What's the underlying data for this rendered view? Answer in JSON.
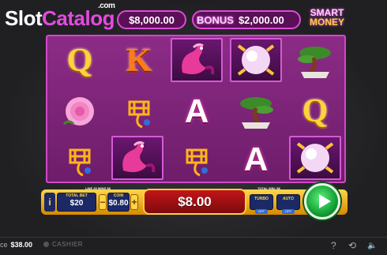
{
  "header": {
    "logo_slot": "Slot",
    "logo_catalog": "Catalog",
    "logo_com": ".com",
    "jackpot_main": "$8,000.00",
    "bonus_label": "BONUS",
    "bonus_value": "$2,000.00",
    "smart_label": "SMART",
    "money_label": "MONEY"
  },
  "reels": {
    "letters": {
      "q": "Q",
      "k": "K",
      "a": "A"
    }
  },
  "controls": {
    "info_label": "i",
    "lines_note": "LINE 25 WINS $8",
    "total_bet_label": "TOTAL BET",
    "total_bet_value": "$20",
    "minus_label": "−",
    "coin_label": "COIN",
    "coin_value": "$0.80",
    "plus_label": "+",
    "win_amount": "$8.00",
    "total_win_note": "TOTAL WIN: $8",
    "turbo_label": "TURBO",
    "turbo_state": "OFF",
    "auto_label": "AUTO",
    "auto_state": "OFF"
  },
  "footer": {
    "balance_label": "ce",
    "balance_value": "$38.00",
    "cashier_label": "CASHIER",
    "help_icon": "?",
    "history_icon": "⟲",
    "sound_icon": "🔈"
  },
  "colors": {
    "accent": "#e04ad8",
    "reel_bg": "#8c2b86",
    "spin_green": "#13a036",
    "bar_gold": "#ffd54a"
  }
}
